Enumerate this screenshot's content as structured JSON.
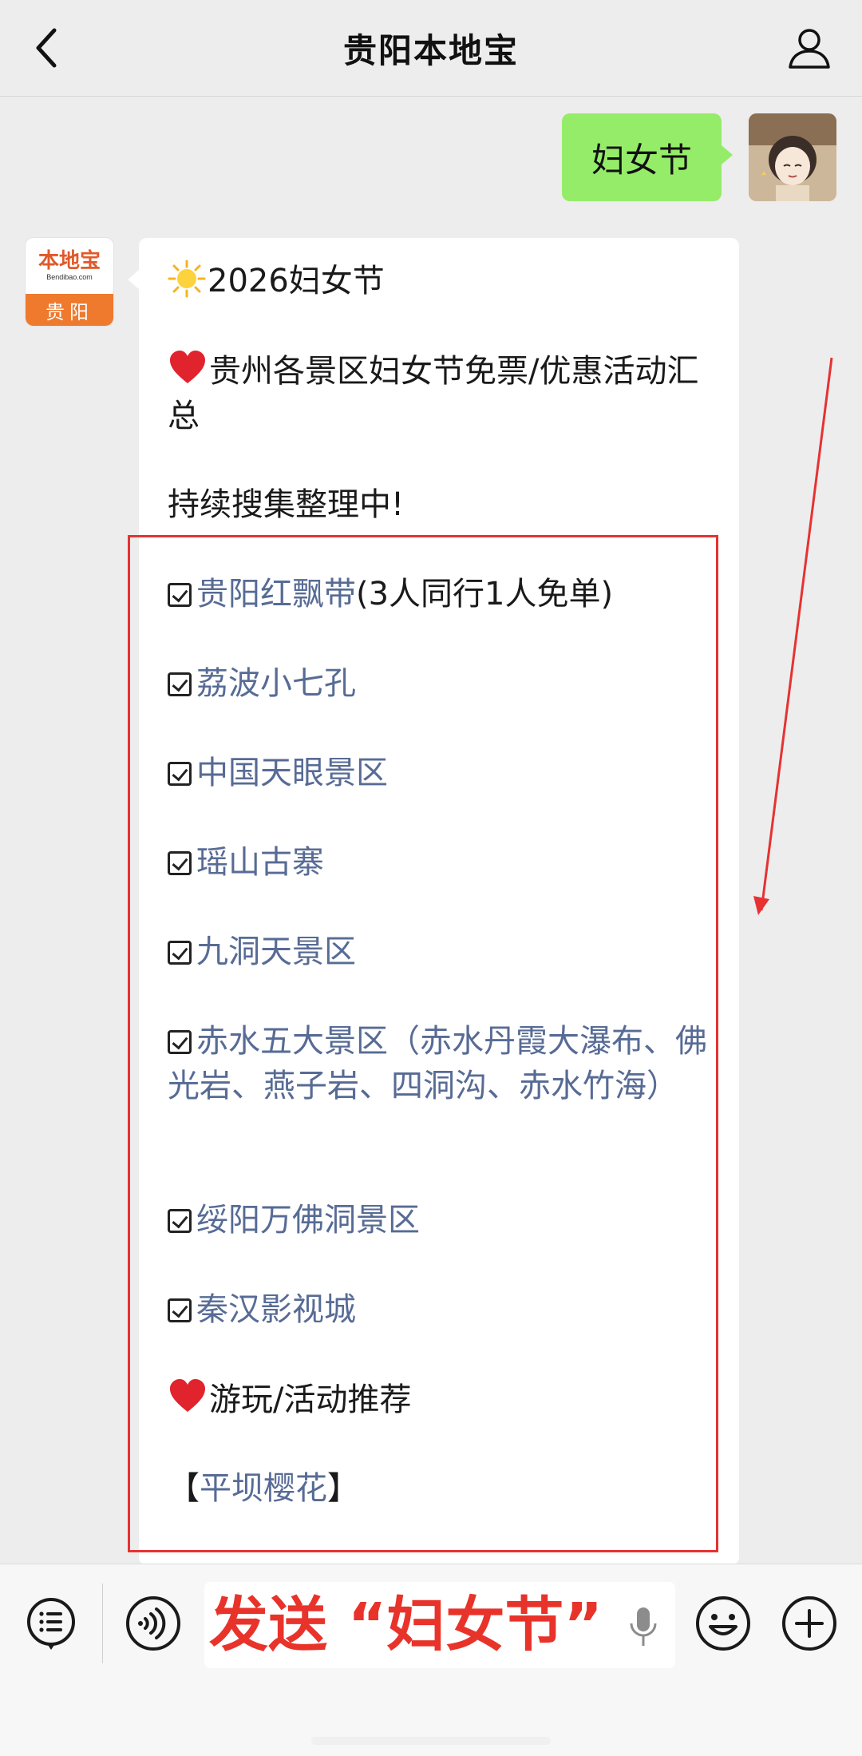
{
  "header": {
    "title": "贵阳本地宝",
    "back_icon": "chevron-left-icon",
    "profile_icon": "person-icon"
  },
  "outgoing": {
    "text": "妇女节",
    "bubble_color": "#95ec69"
  },
  "account": {
    "logo_text": "本地宝",
    "logo_sub": "Bendibao.com",
    "logo_city": "贵阳",
    "brand_color": "#ef7a2e"
  },
  "message": {
    "title": "2026妇女节",
    "headline": "贵州各景区妇女节免票/优惠活动汇总",
    "note": "持续搜集整理中!",
    "items": [
      {
        "name": "贵阳红飘带",
        "suffix": "(3人同行1人免单)"
      },
      {
        "name": "荔波小七孔",
        "suffix": ""
      },
      {
        "name": "中国天眼景区",
        "suffix": ""
      },
      {
        "name": "瑶山古寨",
        "suffix": ""
      },
      {
        "name": "九洞天景区",
        "suffix": ""
      },
      {
        "name": "赤水五大景区（赤水丹霞大瀑布、佛光岩、燕子岩、四洞沟、赤水竹海）",
        "suffix": ""
      },
      {
        "name": "绥阳万佛洞景区",
        "suffix": ""
      },
      {
        "name": "秦汉影视城",
        "suffix": ""
      }
    ],
    "recommend_heading": "游玩/活动推荐",
    "recommend_item": "平坝樱花",
    "recommend_open": "【",
    "recommend_close": "】",
    "link_color": "#576b95"
  },
  "annotation": {
    "color": "#e63232"
  },
  "input_bar": {
    "menu_icon": "list-menu-icon",
    "voice_icon": "voice-icon",
    "text": "发送 “妇女节”",
    "mic_icon": "microphone-icon",
    "emoji_icon": "smiley-icon",
    "plus_icon": "plus-circle-icon"
  }
}
